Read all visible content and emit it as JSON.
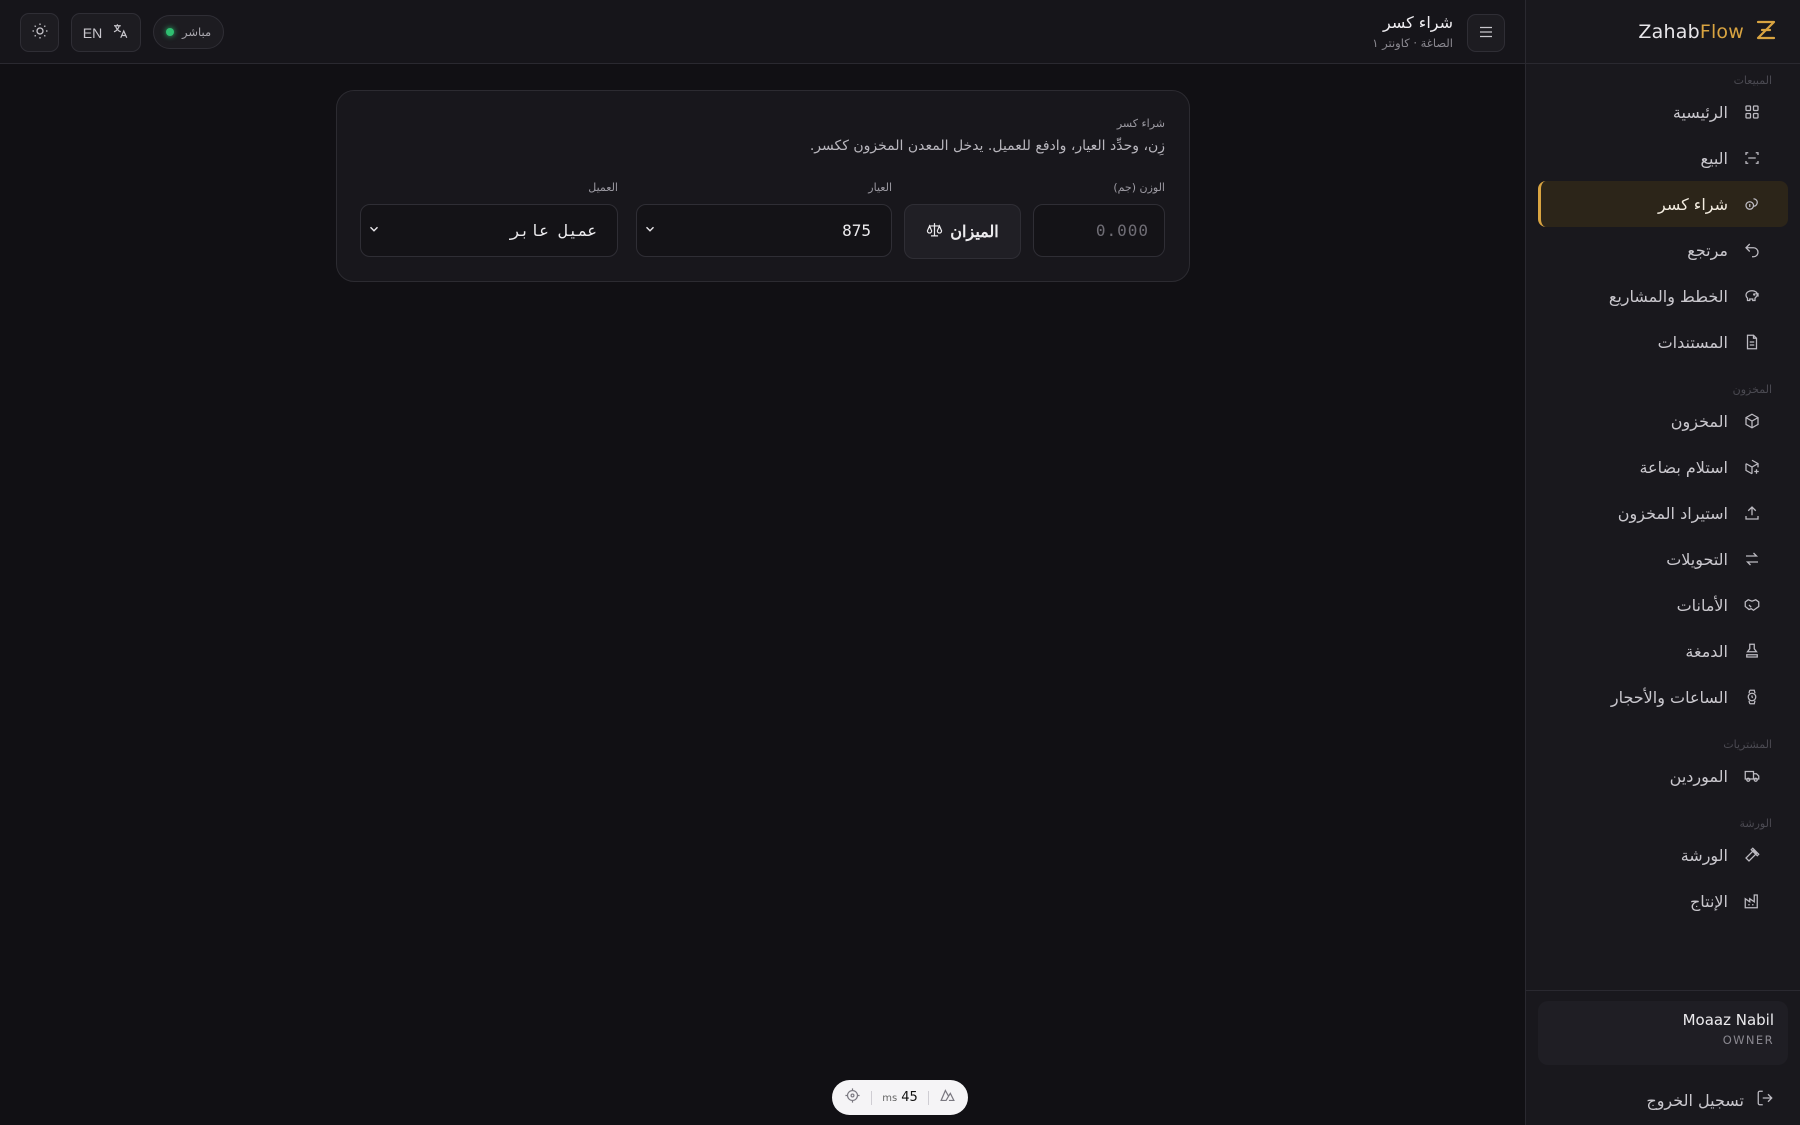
{
  "brand": {
    "name_main": "Zahab",
    "name_accent": "Flow"
  },
  "header": {
    "title": "شراء كسر",
    "subtitle": "الصاغة · كاونتر ١",
    "lang_label": "EN",
    "status_label": "مباشر"
  },
  "sidebar": {
    "sections": [
      {
        "label": "المبيعات",
        "items": [
          {
            "label": "الرئيسية",
            "icon": "dashboard-icon",
            "active": false
          },
          {
            "label": "البيع",
            "icon": "scan-icon",
            "active": false
          },
          {
            "label": "شراء كسر",
            "icon": "coins-icon",
            "active": true
          },
          {
            "label": "مرتجع",
            "icon": "undo-icon",
            "active": false
          },
          {
            "label": "الخطط والمشاريع",
            "icon": "piggy-bank-icon",
            "active": false
          },
          {
            "label": "المستندات",
            "icon": "document-icon",
            "active": false
          }
        ]
      },
      {
        "label": "المخزون",
        "items": [
          {
            "label": "المخزون",
            "icon": "box-icon",
            "active": false
          },
          {
            "label": "استلام بضاعة",
            "icon": "box-plus-icon",
            "active": false
          },
          {
            "label": "استيراد المخزون",
            "icon": "upload-icon",
            "active": false
          },
          {
            "label": "التحويلات",
            "icon": "transfer-icon",
            "active": false
          },
          {
            "label": "الأمانات",
            "icon": "handshake-icon",
            "active": false
          },
          {
            "label": "الدمغة",
            "icon": "stamp-icon",
            "active": false
          },
          {
            "label": "الساعات والأحجار",
            "icon": "watch-icon",
            "active": false
          }
        ]
      },
      {
        "label": "المشتريات",
        "items": [
          {
            "label": "الموردين",
            "icon": "truck-icon",
            "active": false
          }
        ]
      },
      {
        "label": "الورشة",
        "items": [
          {
            "label": "الورشة",
            "icon": "hammer-icon",
            "active": false
          },
          {
            "label": "الإنتاج",
            "icon": "factory-icon",
            "active": false
          }
        ]
      }
    ],
    "user": {
      "name": "Moaaz Nabil",
      "role": "OWNER"
    },
    "logout_label": "تسجيل الخروج"
  },
  "card": {
    "eyebrow": "شراء كسر",
    "description": "زِن، وحدِّد العيار، وادفع للعميل. يدخل المعدن المخزون ككسر.",
    "weight_label": "الوزن (جم)",
    "weight_placeholder": "0.000",
    "scale_label": "الميزان",
    "karat_label": "العيار",
    "karat_value": "875",
    "client_label": "العميل",
    "client_value": "عميل عابر"
  },
  "perf": {
    "value": "45",
    "unit": "ms"
  },
  "colors": {
    "accent": "#d9a441",
    "live": "#2fbf71",
    "background": "#111014"
  }
}
